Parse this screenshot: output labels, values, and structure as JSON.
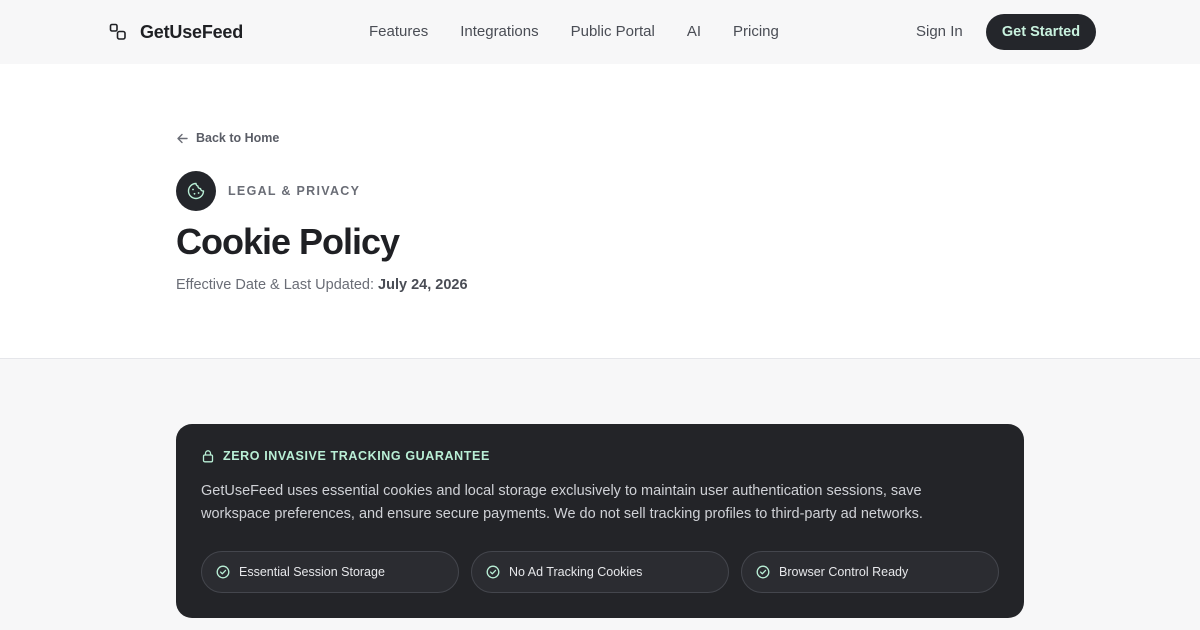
{
  "nav": {
    "brand": "GetUseFeed",
    "links": [
      "Features",
      "Integrations",
      "Public Portal",
      "AI",
      "Pricing"
    ],
    "sign_in": "Sign In",
    "cta": "Get Started"
  },
  "hero": {
    "back_label": "Back to Home",
    "eyebrow": "LEGAL & PRIVACY",
    "title": "Cookie Policy",
    "date_prefix": "Effective Date & Last Updated: ",
    "date_value": "July 24, 2026"
  },
  "card": {
    "label": "ZERO INVASIVE TRACKING GUARANTEE",
    "body": "GetUseFeed uses essential cookies and local storage exclusively to maintain user authentication sessions, save workspace preferences, and ensure secure payments. We do not sell tracking profiles to third-party ad networks.",
    "pills": [
      "Essential Session Storage",
      "No Ad Tracking Cookies",
      "Browser Control Ready"
    ]
  },
  "icons": {
    "brand": "logo-squares-icon",
    "back": "arrow-left-icon",
    "badge": "cookie-icon",
    "card_head": "lock-icon",
    "pill": "check-circle-icon"
  },
  "colors": {
    "dark": "#24262b",
    "accent_mint": "#b9efd6",
    "page_bg": "#f7f7f8",
    "hero_bg": "#ffffff"
  }
}
